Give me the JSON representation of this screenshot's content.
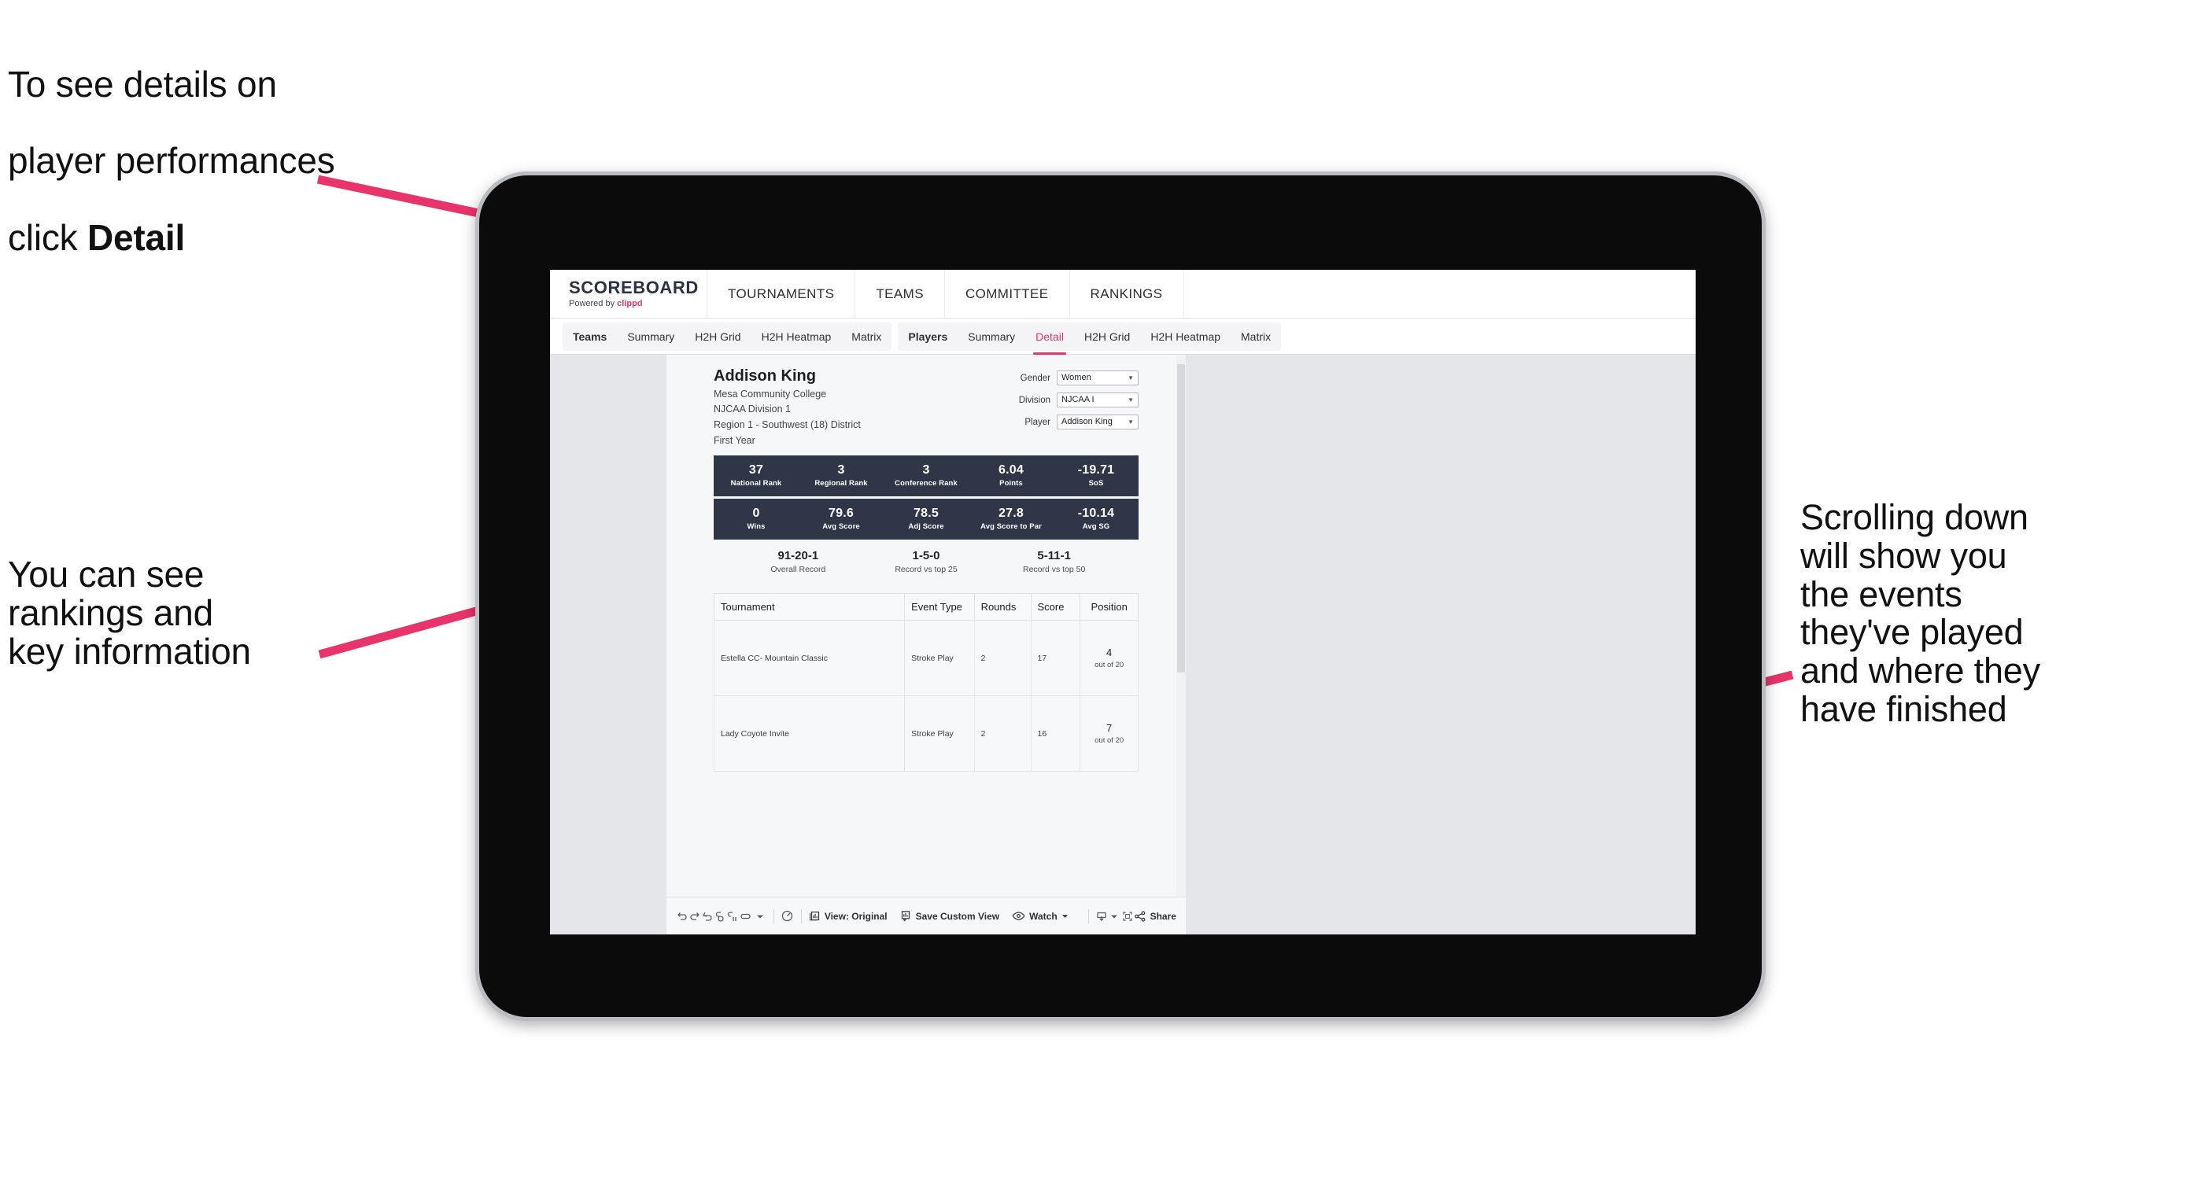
{
  "annotations": {
    "top_left_line1": "To see details on",
    "top_left_line2": "player performances",
    "top_left_line3_prefix": "click ",
    "top_left_line3_bold": "Detail",
    "mid_left": "You can see\nrankings and\nkey information",
    "right": "Scrolling down\nwill show you\nthe events\nthey've played\nand where they\nhave finished",
    "arrow_color": "#e8346a"
  },
  "app": {
    "brand": {
      "name": "SCOREBOARD",
      "powered_prefix": "Powered by ",
      "powered_brand": "clippd"
    },
    "topnav": [
      {
        "label": "TOURNAMENTS"
      },
      {
        "label": "TEAMS"
      },
      {
        "label": "COMMITTEE"
      },
      {
        "label": "RANKINGS"
      }
    ],
    "subnav": {
      "group_teams": [
        {
          "label": "Teams",
          "active": false,
          "head": true
        },
        {
          "label": "Summary",
          "active": false,
          "head": false
        },
        {
          "label": "H2H Grid",
          "active": false,
          "head": false
        },
        {
          "label": "H2H Heatmap",
          "active": false,
          "head": false
        },
        {
          "label": "Matrix",
          "active": false,
          "head": false
        }
      ],
      "group_players": [
        {
          "label": "Players",
          "active": false,
          "head": true
        },
        {
          "label": "Summary",
          "active": false,
          "head": false
        },
        {
          "label": "Detail",
          "active": true,
          "head": false
        },
        {
          "label": "H2H Grid",
          "active": false,
          "head": false
        },
        {
          "label": "H2H Heatmap",
          "active": false,
          "head": false
        },
        {
          "label": "Matrix",
          "active": false,
          "head": false
        }
      ]
    },
    "accent_color": "#e8346a",
    "band_color": "#2e3648"
  },
  "player": {
    "name": "Addison King",
    "school": "Mesa Community College",
    "division": "NJCAA Division 1",
    "region": "Region 1 - Southwest (18) District",
    "year": "First Year"
  },
  "filters": [
    {
      "label": "Gender",
      "value": "Women"
    },
    {
      "label": "Division",
      "value": "NJCAA I"
    },
    {
      "label": "Player",
      "value": "Addison King"
    }
  ],
  "stats_band_1": [
    {
      "value": "37",
      "label": "National Rank"
    },
    {
      "value": "3",
      "label": "Regional Rank"
    },
    {
      "value": "3",
      "label": "Conference Rank"
    },
    {
      "value": "6.04",
      "label": "Points"
    },
    {
      "value": "-19.71",
      "label": "SoS"
    }
  ],
  "stats_band_2": [
    {
      "value": "0",
      "label": "Wins"
    },
    {
      "value": "79.6",
      "label": "Avg Score"
    },
    {
      "value": "78.5",
      "label": "Adj Score"
    },
    {
      "value": "27.8",
      "label": "Avg Score to Par"
    },
    {
      "value": "-10.14",
      "label": "Avg SG"
    }
  ],
  "records": [
    {
      "value": "91-20-1",
      "label": "Overall Record"
    },
    {
      "value": "1-5-0",
      "label": "Record vs top 25"
    },
    {
      "value": "5-11-1",
      "label": "Record vs top 50"
    }
  ],
  "table": {
    "columns": [
      "Tournament",
      "Event Type",
      "Rounds",
      "Score",
      "Position"
    ],
    "rows": [
      {
        "tournament": "Estella CC- Mountain Classic",
        "event_type": "Stroke Play",
        "rounds": "2",
        "score": "17",
        "position_num": "4",
        "position_sub": "out of 20"
      },
      {
        "tournament": "Lady Coyote Invite",
        "event_type": "Stroke Play",
        "rounds": "2",
        "score": "16",
        "position_num": "7",
        "position_sub": "out of 20"
      }
    ]
  },
  "toolbar": {
    "view_label": "View: Original",
    "save_label": "Save Custom View",
    "watch_label": "Watch",
    "share_label": "Share",
    "icons": [
      "undo-icon",
      "redo-icon",
      "revert-icon",
      "refresh-icon",
      "pause-icon",
      "pill-icon",
      "chevron-down-icon",
      "clock-icon"
    ]
  }
}
